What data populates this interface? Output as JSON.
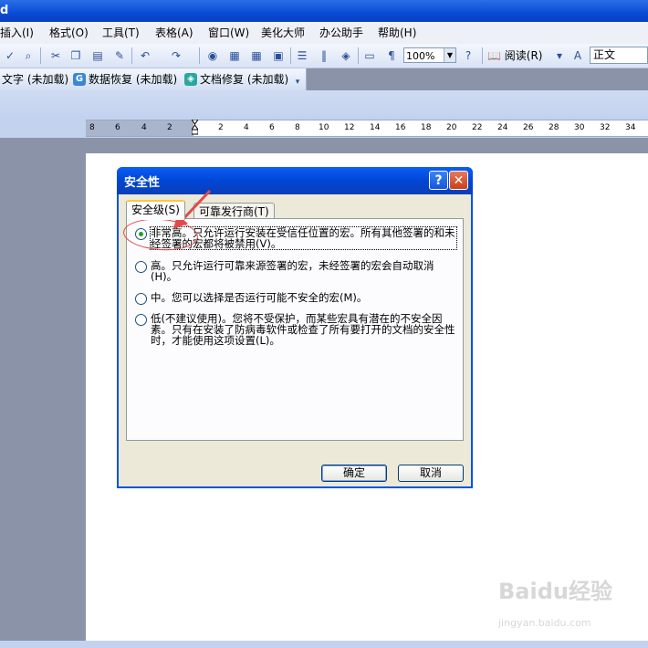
{
  "app": {
    "title_fragment": "d"
  },
  "menu": [
    "插入(I)",
    "格式(O)",
    "工具(T)",
    "表格(A)",
    "窗口(W)",
    "美化大师",
    "办公助手",
    "帮助(H)"
  ],
  "toolbar": {
    "zoom": "100%",
    "read_label": "阅读(R)",
    "style_value": "正文"
  },
  "addins": [
    {
      "label": "文字 (未加载)"
    },
    {
      "label": "数据恢复 (未加载)"
    },
    {
      "label": "文档修复 (未加载)"
    }
  ],
  "ruler": {
    "numbers": [
      "8",
      "6",
      "4",
      "2",
      "2",
      "4",
      "6",
      "8",
      "10",
      "12",
      "14",
      "16",
      "18",
      "20",
      "22",
      "24",
      "26",
      "28",
      "30",
      "32",
      "34"
    ]
  },
  "dialog": {
    "title": "安全性",
    "help": "?",
    "close": "✕",
    "tabs": [
      {
        "label": "安全级(S)",
        "active": true
      },
      {
        "label": "可靠发行商(T)",
        "active": false
      }
    ],
    "options": [
      {
        "text": "非常高。只允许运行安装在受信任位置的宏。所有其他签署的和未经签署的宏都将被禁用(V)。",
        "checked": true
      },
      {
        "text": "高。只允许运行可靠来源签署的宏，未经签署的宏会自动取消(H)。",
        "checked": false
      },
      {
        "text": "中。您可以选择是否运行可能不安全的宏(M)。",
        "checked": false
      },
      {
        "text": "低(不建议使用)。您将不受保护，而某些宏具有潜在的不安全因素。只有在安装了防病毒软件或检查了所有要打开的文档的安全性时，才能使用这项设置(L)。",
        "checked": false
      }
    ],
    "ok": "确定",
    "cancel": "取消"
  },
  "watermark": {
    "main": "Baidu经验",
    "sub": "jingyan.baidu.com"
  },
  "colors": {
    "titlebar": "#0a4bd6",
    "dialog_bg": "#ece9d8",
    "annotation": "#e24a4a",
    "radio_check": "#21a121"
  }
}
